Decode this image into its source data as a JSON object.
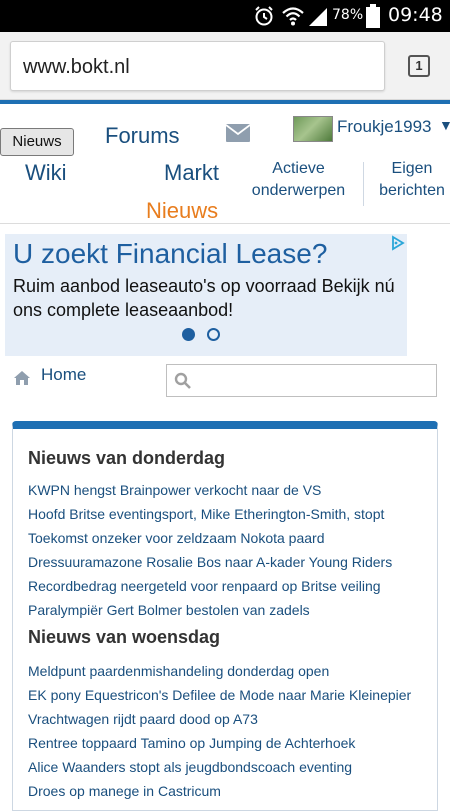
{
  "status_bar": {
    "battery_percent": "78%",
    "time": "09:48",
    "icons": [
      "alarm-icon",
      "wifi-icon",
      "signal-icon",
      "battery-icon"
    ]
  },
  "browser": {
    "url": "www.bokt.nl",
    "tab_count": "1"
  },
  "header": {
    "nav_toggle_label": "Nieuws",
    "nav": {
      "forums": "Forums",
      "wiki": "Wiki",
      "markt": "Markt",
      "nieuws": "Nieuws"
    },
    "sub_nav": {
      "actieve_line1": "Actieve",
      "actieve_line2": "onderwerpen",
      "eigen_line1": "Eigen",
      "eigen_line2": "berichten"
    },
    "username": "Froukje1993",
    "active_color": "#e87d1e",
    "accent_color": "#1e6fb3"
  },
  "ad": {
    "title": "U zoekt Financial Lease?",
    "body": "Ruim aanbod leaseauto's op voorraad Bekijk nú ons complete leaseaanbod!",
    "slides": 2,
    "active_slide": 1
  },
  "breadcrumb": {
    "home": "Home"
  },
  "search": {
    "value": "",
    "placeholder": ""
  },
  "news": {
    "sections": [
      {
        "heading": "Nieuws van donderdag",
        "items": [
          "KWPN hengst Brainpower verkocht naar de VS",
          "Hoofd Britse eventingsport, Mike Etherington-Smith, stopt",
          "Toekomst onzeker voor zeldzaam Nokota paard",
          "Dressuuramazone Rosalie Bos naar A-kader Young Riders",
          "Recordbedrag neergeteld voor renpaard op Britse veiling",
          "Paralympiër Gert Bolmer bestolen van zadels"
        ]
      },
      {
        "heading": "Nieuws van woensdag",
        "items": [
          "Meldpunt paardenmishandeling donderdag open",
          "EK pony Equestricon's Defilee de Mode naar Marie Kleinepier",
          "Vrachtwagen rijdt paard dood op A73",
          "Rentree toppaard Tamino op Jumping de Achterhoek",
          "Alice Waanders stopt als jeugdbondscoach eventing",
          "Droes op manege in Castricum"
        ]
      }
    ]
  }
}
